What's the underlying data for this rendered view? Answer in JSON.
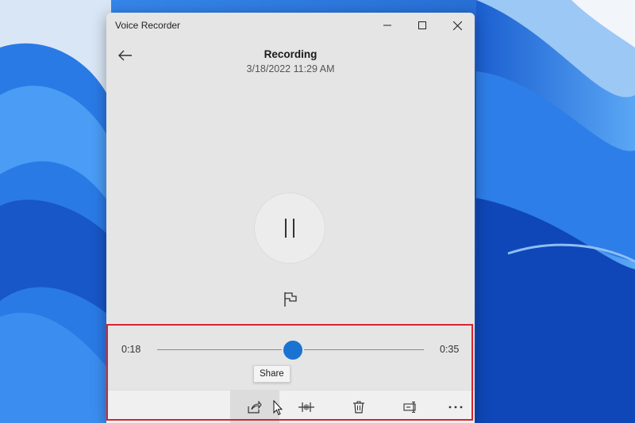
{
  "window": {
    "app_title": "Voice Recorder"
  },
  "recording": {
    "title": "Recording",
    "date": "3/18/2022 11:29 AM"
  },
  "playback": {
    "elapsed": "0:18",
    "duration": "0:35",
    "progress_fraction": 0.51,
    "tooltip": "Share"
  },
  "toolbar": {
    "items": [
      {
        "icon": "share-icon",
        "label": "Share"
      },
      {
        "icon": "trim-icon",
        "label": "Trim"
      },
      {
        "icon": "delete-icon",
        "label": "Delete"
      },
      {
        "icon": "rename-icon",
        "label": "Rename"
      },
      {
        "icon": "more-icon",
        "label": "More"
      }
    ]
  },
  "colors": {
    "accent": "#1a73d1",
    "highlight_border": "#d9232d",
    "window_bg": "#e5e5e5",
    "desktop_bg": "#1e63d6"
  }
}
